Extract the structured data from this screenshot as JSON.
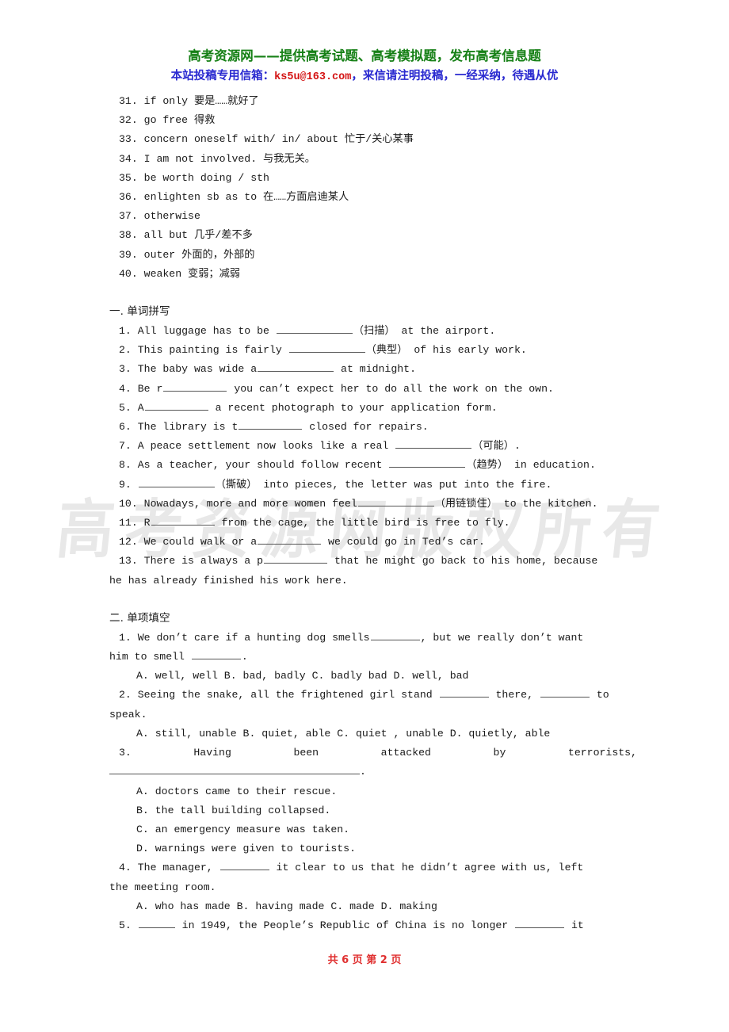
{
  "header": {
    "title": "高考资源网——提供高考试题、高考模拟题，发布高考信息题",
    "sub_prefix": "本站投稿专用信箱：",
    "email": "ks5u@163.com",
    "sub_suffix": "，来信请注明投稿，一经采纳，待遇从优"
  },
  "watermark": "高考资源网版权所有",
  "vocab": [
    "31. if only 要是……就好了",
    "32. go free 得救",
    "33. concern oneself with/ in/ about 忙于/关心某事",
    "34. I am not involved. 与我无关。",
    "35. be worth doing / sth",
    "36. enlighten sb as to 在……方面启迪某人",
    "37. otherwise",
    "38. all but 几乎/差不多",
    "39. outer 外面的，外部的",
    "40. weaken 变弱；减弱"
  ],
  "section1": {
    "heading": "一. 单词拼写",
    "items": [
      {
        "num": "1.",
        "pre": "All luggage has to be ",
        "blank": "b-xl",
        "post": "（扫描） at the airport."
      },
      {
        "num": "2.",
        "pre": "This painting is fairly ",
        "blank": "b-xl",
        "post": "（典型） of his early work."
      },
      {
        "num": "3.",
        "pre": "The baby was wide a",
        "blank": "b-xl",
        "post": " at midnight."
      },
      {
        "num": "4.",
        "pre": "Be r",
        "blank": "b-l",
        "post": " you can’t expect her to do all the work on the own."
      },
      {
        "num": "5.",
        "pre": "A",
        "blank": "b-l",
        "post": " a recent photograph to your application form."
      },
      {
        "num": "6.",
        "pre": "The library is t",
        "blank": "b-l",
        "post": " closed for repairs."
      },
      {
        "num": "7.",
        "pre": "A peace settlement now looks like a real ",
        "blank": "b-xl",
        "post": "（可能）."
      },
      {
        "num": "8.",
        "pre": "As a teacher, your should follow recent ",
        "blank": "b-xl",
        "post": "（趋势） in education."
      },
      {
        "num": "9.",
        "pre": "",
        "blank": "b-xl",
        "post": "（撕破） into pieces, the letter was put into the fire."
      },
      {
        "num": "10.",
        "pre": "Nowadays, more and more women feel",
        "blank": "b-xl",
        "post": "（用链锁住） to the kitchen."
      },
      {
        "num": "11.",
        "pre": "R",
        "blank": "b-l",
        "post": " from the cage, the little bird is free to fly."
      },
      {
        "num": "12.",
        "pre": "We could walk or a",
        "blank": "b-l",
        "post": " we could go in Ted’s car."
      }
    ],
    "item13_line1": "13. There is always a p",
    "item13_blank": "b-l",
    "item13_mid": " that he might go back to his home, because",
    "item13_line2": "he has already finished his work here."
  },
  "section2": {
    "heading": "二. 单项填空",
    "q1": {
      "line1_pre": "1. We don’t care if a hunting dog smells",
      "line1_post": ", but we really don’t want",
      "line2_pre": "him to smell ",
      "line2_post": ".",
      "options": "A. well, well  B. bad, badly  C. badly bad   D. well, bad"
    },
    "q2": {
      "line1_pre": "2. Seeing the snake, all the frightened girl stand ",
      "line1_mid": " there, ",
      "line1_post": " to",
      "line2": "speak.",
      "options": "A. still, unable  B. quiet, able  C. quiet , unable  D. quietly, able"
    },
    "q3": {
      "words": [
        "3.",
        "Having",
        "been",
        "attacked",
        "by",
        "terrorists,"
      ],
      "line2_post": ".",
      "options": [
        "A. doctors came to their rescue.",
        "B. the tall building collapsed.",
        "C. an emergency measure was taken.",
        "D. warnings were given to tourists."
      ]
    },
    "q4": {
      "line1_pre": "4. The manager, ",
      "line1_post": " it clear to us that he didn’t agree with us, left",
      "line2": "the meeting room.",
      "options": "A. who has made    B. having made    C. made     D. making"
    },
    "q5": {
      "line1_pre": "5. ",
      "line1_mid": " in 1949, the People’s Republic of China is no longer ",
      "line1_post": " it"
    }
  },
  "footer": "共 6 页  第 2 页"
}
